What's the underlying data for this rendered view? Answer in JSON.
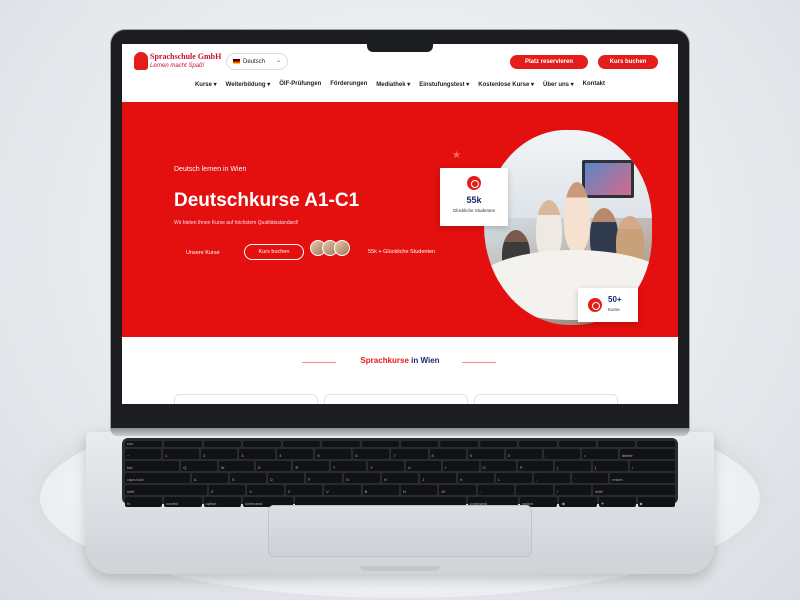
{
  "header": {
    "logo_name": "Sprachschule GmbH",
    "logo_tagline": "Lernen macht Spaß!",
    "language": "Deutsch",
    "btn_reserve": "Platz reservieren",
    "btn_courses": "Kurs buchen",
    "nav": [
      "Kurse ▾",
      "Weiterbildung ▾",
      "ÖIF-Prüfungen",
      "Förderungen",
      "Mediathek ▾",
      "Einstufungstest ▾",
      "Kostenlose Kurse ▾",
      "Über uns ▾",
      "Kontakt"
    ]
  },
  "hero": {
    "kicker": "Deutsch lernen in Wien",
    "title": "Deutschkurse A1-C1",
    "subtitle": "Wir bieten Ihnen Kurse auf höchstem Qualitätsstandard!",
    "link": "Unsere Kurse",
    "button": "Kurs buchen",
    "avatars_text": "55k + Glückliche Studenten",
    "stat1_value": "55k",
    "stat1_label": "Glückliche Studenten",
    "stat2_value": "50+",
    "stat2_label": "Kurse"
  },
  "section": {
    "title_part1": "Sprachkurse",
    "title_part2": "in Wien"
  },
  "keyboard": {
    "row1": [
      "esc",
      "",
      "",
      "",
      "",
      "",
      "",
      "",
      "",
      "",
      "",
      "",
      "",
      ""
    ],
    "row2": [
      "~",
      "1",
      "2",
      "3",
      "4",
      "5",
      "6",
      "7",
      "8",
      "9",
      "0",
      "-",
      "=",
      "delete"
    ],
    "row3": [
      "tab",
      "Q",
      "W",
      "E",
      "R",
      "T",
      "Y",
      "U",
      "I",
      "O",
      "P",
      "[",
      "]",
      "\\"
    ],
    "row4": [
      "caps lock",
      "A",
      "S",
      "D",
      "F",
      "G",
      "H",
      "J",
      "K",
      "L",
      ";",
      "'",
      "return"
    ],
    "row5": [
      "shift",
      "Z",
      "X",
      "C",
      "V",
      "B",
      "N",
      "M",
      ",",
      ".",
      "/",
      "shift"
    ],
    "row6": [
      "fn",
      "control",
      "option",
      "command",
      "",
      "command",
      "option",
      "◀",
      "▼",
      "▶"
    ]
  },
  "colors": {
    "brand_red": "#e31d1a",
    "navy": "#1a2a6c"
  }
}
